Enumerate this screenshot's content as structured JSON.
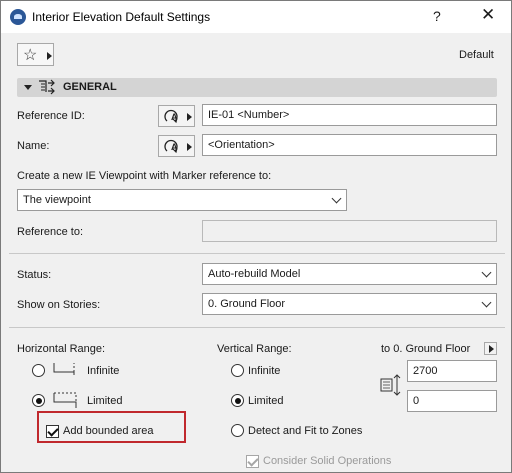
{
  "window": {
    "title": "Interior Elevation Default Settings",
    "help_glyph": "?",
    "close_glyph": "✕"
  },
  "toolbar": {
    "favorites_icon": "star-icon",
    "default_label": "Default"
  },
  "section": {
    "title": "GENERAL",
    "icon": "interior-elevation-icon"
  },
  "general": {
    "reference_id_label": "Reference ID:",
    "reference_id_value": "IE-01 <Number>",
    "name_label": "Name:",
    "name_value": "<Orientation>",
    "create_label": "Create a new IE Viewpoint with Marker reference to:",
    "create_value": "The viewpoint",
    "reference_to_label": "Reference to:",
    "reference_to_value": ""
  },
  "status": {
    "status_label": "Status:",
    "status_value": "Auto-rebuild Model",
    "stories_label": "Show on Stories:",
    "stories_value": "0. Ground Floor"
  },
  "horizontal_range": {
    "label": "Horizontal Range:",
    "options": [
      {
        "label": "Infinite",
        "checked": false
      },
      {
        "label": "Limited",
        "checked": true
      }
    ],
    "add_bounded_label": "Add bounded area",
    "add_bounded_checked": true
  },
  "vertical_range": {
    "label": "Vertical Range:",
    "options": [
      {
        "label": "Infinite",
        "checked": false
      },
      {
        "label": "Limited",
        "checked": true
      },
      {
        "label": "Detect and Fit to Zones",
        "checked": false
      }
    ],
    "to_story_label": "to 0. Ground Floor",
    "top_value": "2700",
    "bottom_value": "0",
    "consider_solid_label": "Consider Solid Operations",
    "consider_solid_checked": true
  },
  "colors": {
    "highlight": "#c0282d",
    "section_header": "#d4d4d4",
    "dialog_bg": "#f0f0f0"
  }
}
